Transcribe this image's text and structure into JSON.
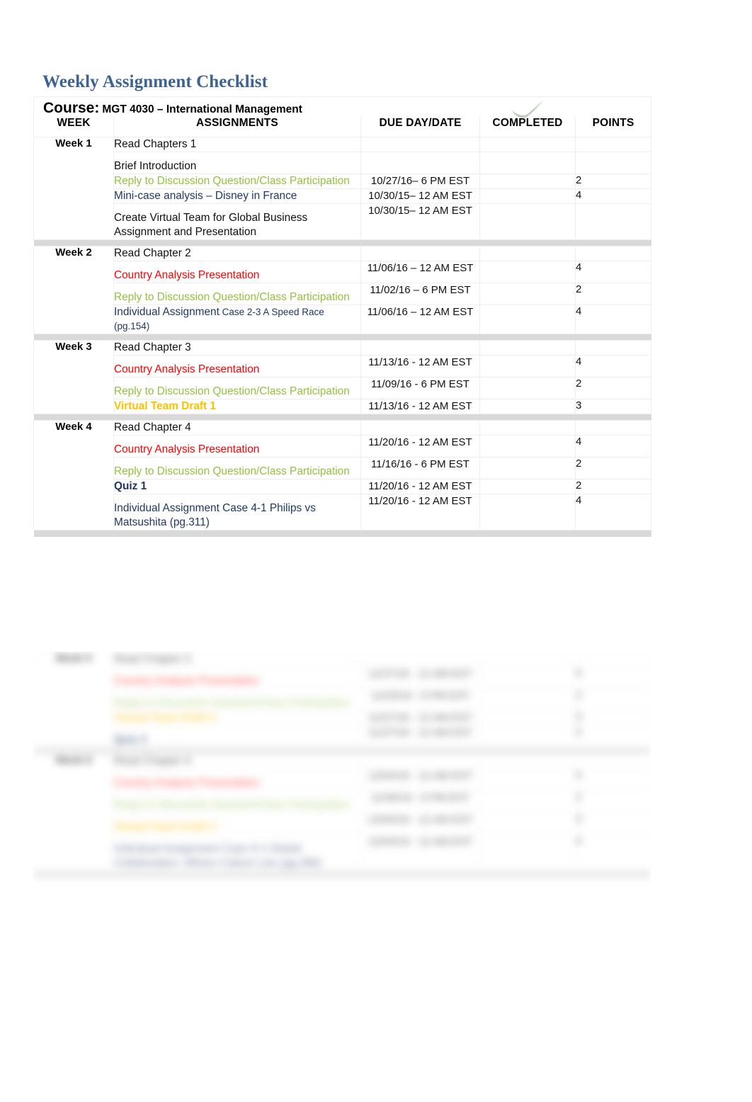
{
  "document": {
    "title": "Weekly Assignment Checklist",
    "course_label": "Course:",
    "course_value": "MGT 4030 – International Management"
  },
  "table": {
    "headers": {
      "week": "WEEK",
      "assignments": "ASSIGNMENTS",
      "due": "DUE DAY/DATE",
      "completed": "COMPLETED",
      "points": "POINTS"
    },
    "completed_icon": "green-checkmark-icon",
    "colors": {
      "title_blue": "#3D6394",
      "green": "#92C13D",
      "navy": "#1F3864",
      "red": "#FF0000",
      "gold": "#FFC000",
      "separator_gray": "#D9D9D9"
    },
    "weeks": [
      {
        "label": "Week 1",
        "rows": [
          {
            "text": "Read Chapters 1",
            "color": "black",
            "due": "",
            "points": "",
            "spaced": false
          },
          {
            "text": "Brief Introduction",
            "color": "black",
            "due": "",
            "points": "",
            "spaced": true
          },
          {
            "text": "Reply to Discussion Question/Class Participation",
            "color": "green",
            "due": "10/27/16– 6 PM EST",
            "points": "2",
            "spaced": false
          },
          {
            "text": "Mini-case analysis – Disney in France",
            "color": "blue",
            "due": "10/30/15– 12 AM EST",
            "points": "4",
            "spaced": false
          },
          {
            "text": "Create Virtual Team for Global Business Assignment and Presentation",
            "color": "black",
            "due": "10/30/15– 12 AM EST",
            "points": "",
            "spaced": true
          }
        ]
      },
      {
        "label": "Week 2",
        "rows": [
          {
            "text": "Read Chapter 2",
            "color": "black",
            "due": "",
            "points": "",
            "spaced": false
          },
          {
            "text": "Country Analysis Presentation",
            "color": "red",
            "due": "11/06/16 – 12 AM EST",
            "points": "4",
            "spaced": true
          },
          {
            "text": "Reply to Discussion Question/Class Participation",
            "color": "green",
            "due": "11/02/16 – 6 PM EST",
            "points": "2",
            "spaced": true
          },
          {
            "text": "Individual Assignment",
            "sub": " Case 2-3 A Speed Race (pg.154)",
            "color": "blue",
            "due": "11/06/16 – 12 AM EST",
            "points": "4",
            "spaced": false
          }
        ]
      },
      {
        "label": "Week 3",
        "rows": [
          {
            "text": "Read Chapter 3",
            "color": "black",
            "due": "",
            "points": "",
            "spaced": false
          },
          {
            "text": "Country Analysis Presentation",
            "color": "red",
            "due": "11/13/16 -  12 AM EST",
            "points": "4",
            "spaced": true
          },
          {
            "text": "Reply to Discussion Question/Class Participation",
            "color": "green",
            "due": "11/09/16 -  6 PM EST",
            "points": "2",
            "spaced": true
          },
          {
            "text": "Virtual Team Draft 1",
            "color": "gold",
            "due": "11/13/16 -  12 AM EST",
            "points": "3",
            "spaced": false
          }
        ]
      },
      {
        "label": "Week 4",
        "rows": [
          {
            "text": "Read Chapter 4",
            "color": "black",
            "due": "",
            "points": "",
            "spaced": false
          },
          {
            "text": "Country Analysis Presentation",
            "color": "red",
            "due": "11/20/16 -  12 AM EST",
            "points": "4",
            "spaced": true
          },
          {
            "text": "Reply to Discussion Question/Class Participation",
            "color": "green",
            "due": "11/16/16 -  6 PM EST",
            "points": "2",
            "spaced": true
          },
          {
            "text": "Quiz 1",
            "color": "navy-bold",
            "due": "11/20/16 -  12 AM EST",
            "points": "2",
            "spaced": false
          },
          {
            "text": "Individual Assignment Case 4-1 Philips vs Matsushita (pg.311)",
            "color": "blue",
            "due": "11/20/16 -  12 AM EST",
            "points": "4",
            "spaced": true
          }
        ]
      },
      {
        "label": "Week 5",
        "blurred": true,
        "rows": [
          {
            "text": "Read Chapter 5",
            "color": "black",
            "due": "",
            "points": "",
            "spaced": false
          },
          {
            "text": "Country Analysis Presentation",
            "color": "red",
            "due": "11/27/16 -  12 AM EST",
            "points": "4",
            "spaced": true
          },
          {
            "text": "Reply to Discussion Question/Class Participation",
            "color": "green",
            "due": "11/23/16 -  6 PM EST",
            "points": "2",
            "spaced": true
          },
          {
            "text": "Virtual Team Draft 2",
            "color": "gold",
            "due": "11/27/16 -  12 AM EST",
            "points": "3",
            "spaced": false
          },
          {
            "text": "Quiz 2",
            "color": "navy-bold",
            "due": "11/27/16 -  12 AM EST",
            "points": "2",
            "spaced": true
          }
        ]
      },
      {
        "label": "Week 6",
        "blurred": true,
        "rows": [
          {
            "text": "Read Chapter 6",
            "color": "black",
            "due": "",
            "points": "",
            "spaced": false
          },
          {
            "text": "Country Analysis Presentation",
            "color": "red",
            "due": "12/04/16 -  12 AM EST",
            "points": "4",
            "spaced": true
          },
          {
            "text": "Reply to Discussion Question/Class Participation",
            "color": "green",
            "due": "11/30/16 -  6 PM EST",
            "points": "2",
            "spaced": true
          },
          {
            "text": "Virtual Team Draft 3",
            "color": "gold",
            "due": "12/04/16 -  12 AM EST",
            "points": "3",
            "spaced": true
          },
          {
            "text": "Individual Assignment Case 6-1 Global Collaboration: Where Culture Lies (pg.386)",
            "color": "blue",
            "due": "12/04/16 -  12 AM EST",
            "points": "4",
            "spaced": true
          }
        ]
      }
    ]
  }
}
